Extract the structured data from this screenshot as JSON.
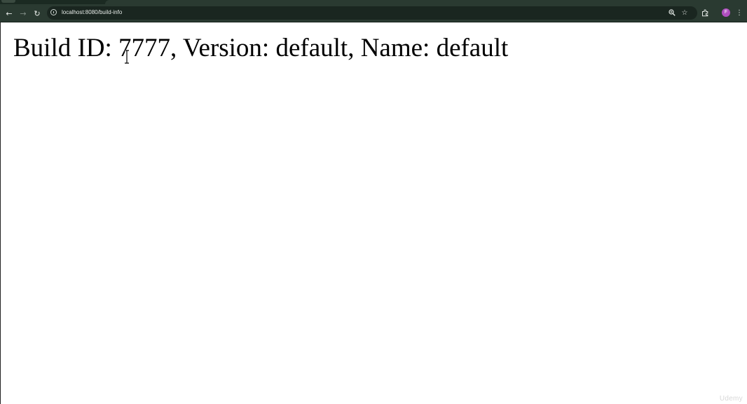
{
  "browser": {
    "url": "localhost:8080/build-info",
    "profile_initial": "F"
  },
  "page": {
    "text": "Build ID: 7777, Version: default, Name: default"
  },
  "watermark": "Udemy",
  "icons": {
    "back": "arrow-left-icon",
    "forward": "arrow-right-icon",
    "reload": "reload-icon",
    "site_info": "info-icon",
    "zoom": "zoom-icon",
    "bookmark": "star-icon",
    "extensions": "puzzle-icon",
    "menu": "kebab-menu-icon"
  },
  "colors": {
    "chrome_dark": "#2a3a31",
    "omnibox": "#1a2620",
    "avatar": "#b04fc0"
  }
}
